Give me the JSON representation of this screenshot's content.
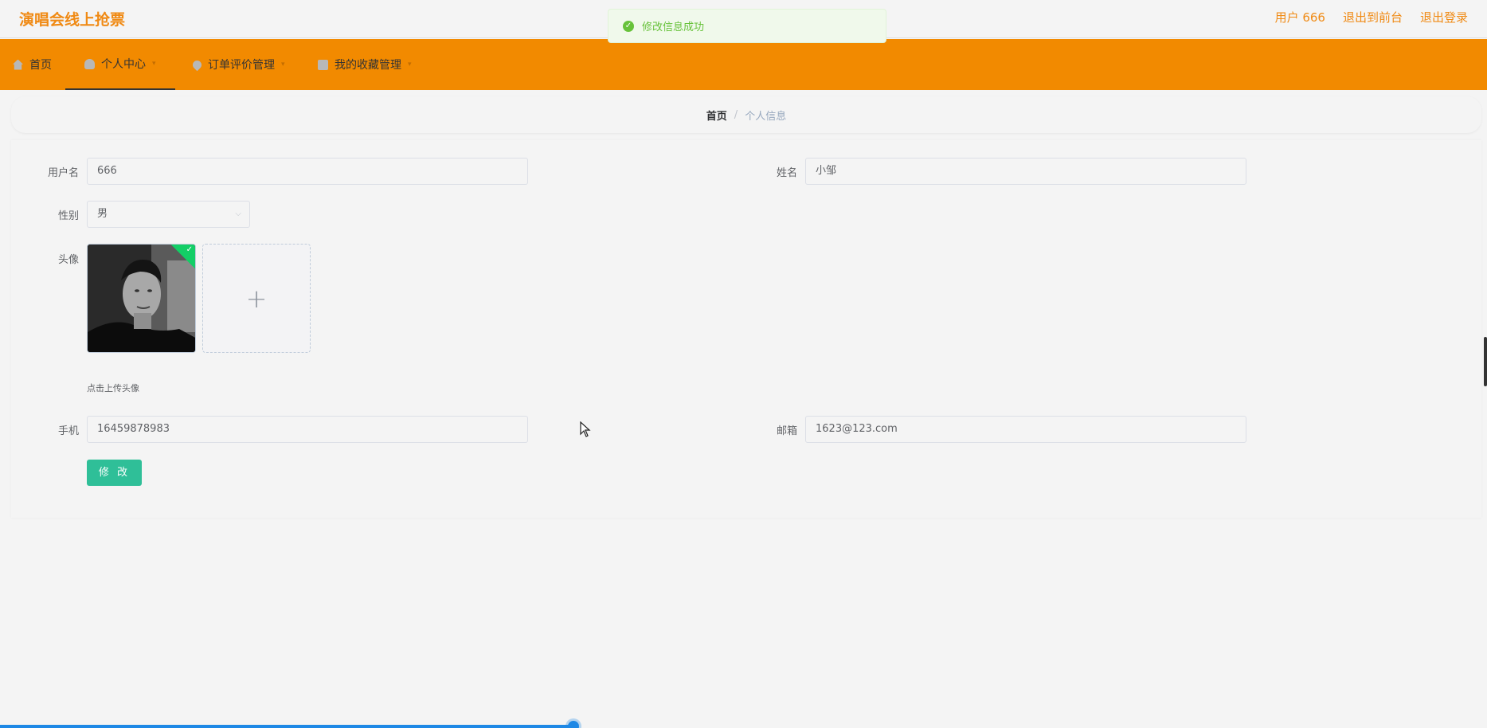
{
  "header": {
    "brand": "演唱会线上抢票",
    "user_label": "用户 666",
    "back_to_front": "退出到前台",
    "logout": "退出登录"
  },
  "toast": {
    "message": "修改信息成功"
  },
  "nav": {
    "items": [
      {
        "label": "首页",
        "icon": "home-icon",
        "has_caret": false
      },
      {
        "label": "个人中心",
        "icon": "user-icon",
        "has_caret": true
      },
      {
        "label": "订单评价管理",
        "icon": "map-pin-icon",
        "has_caret": true
      },
      {
        "label": "我的收藏管理",
        "icon": "box-icon",
        "has_caret": true
      }
    ],
    "active_index": 1
  },
  "breadcrumb": {
    "home": "首页",
    "separator": "/",
    "current": "个人信息"
  },
  "form": {
    "username_label": "用户名",
    "username_value": "666",
    "name_label": "姓名",
    "name_value": "小邹",
    "gender_label": "性别",
    "gender_value": "男",
    "avatar_label": "头像",
    "upload_plus": "+",
    "upload_hint": "点击上传头像",
    "phone_label": "手机",
    "phone_value": "16459878983",
    "email_label": "邮箱",
    "email_value": "1623@123.com",
    "submit_label": "修 改"
  },
  "colors": {
    "brand": "#f08a14",
    "navbar": "#f28a00",
    "primary_button": "#2fbf98",
    "success": "#67c23a"
  }
}
